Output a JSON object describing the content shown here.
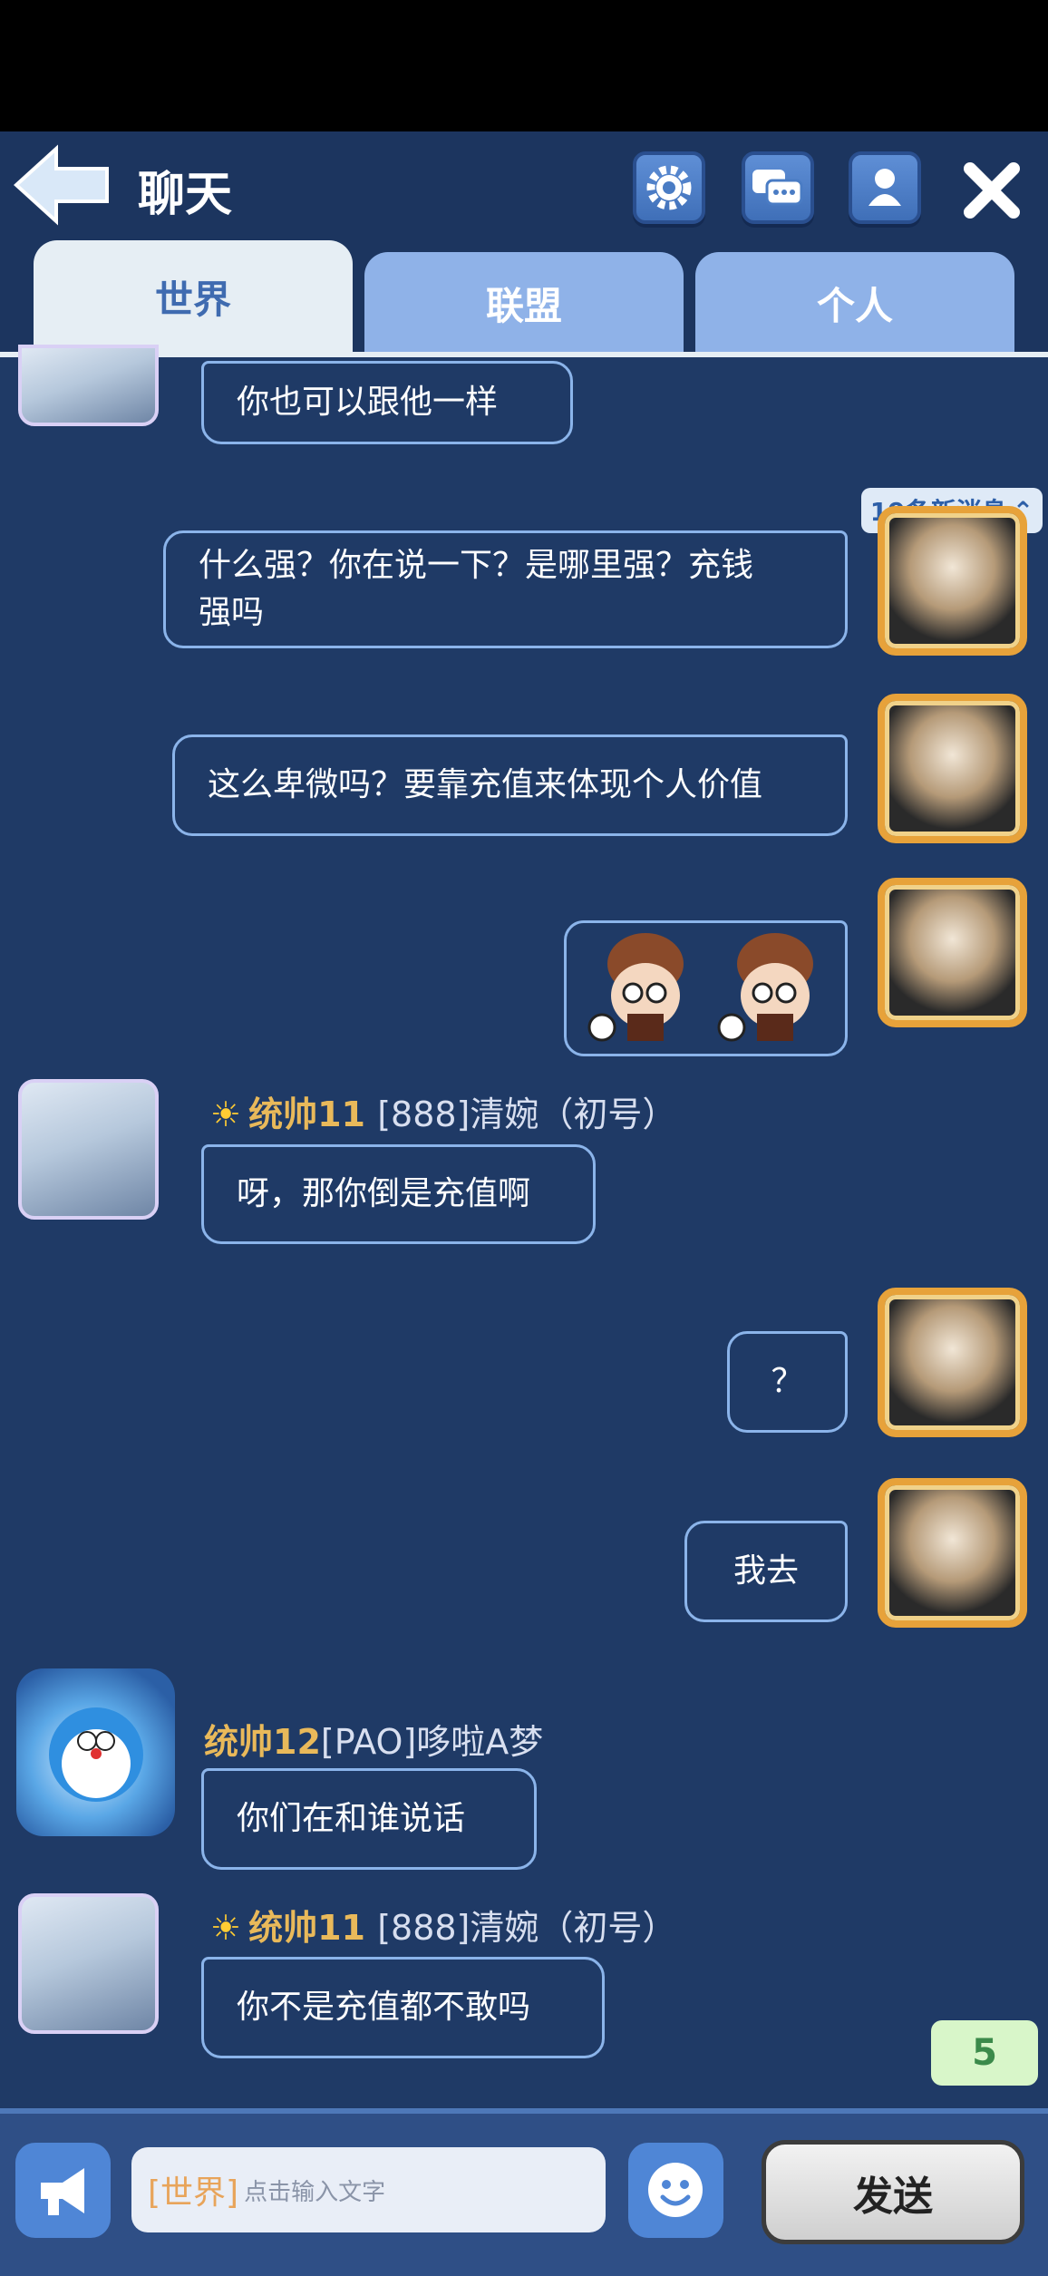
{
  "header": {
    "title": "聊天",
    "tabs": [
      {
        "label": "世界",
        "selected": true
      },
      {
        "label": "联盟",
        "selected": false
      },
      {
        "label": "个人",
        "selected": false
      }
    ],
    "icons": [
      "back-arrow-icon",
      "gear-icon",
      "chat-bubbles-icon",
      "person-icon",
      "close-icon"
    ]
  },
  "new_messages": "19条新消息",
  "messages": [
    {
      "side": "left",
      "text": "你也可以跟他一样"
    },
    {
      "side": "right",
      "text_line1": "什么强？你在说一下？是哪里强？充钱",
      "text_line2": "强吗"
    },
    {
      "side": "right",
      "text": "这么卑微吗？要靠充值来体现个人价值"
    },
    {
      "side": "right",
      "type": "sticker"
    },
    {
      "side": "left",
      "name_prefix": "统帅11",
      "name_rest": "[888]清婉（初号）",
      "text": "呀，那你倒是充值啊"
    },
    {
      "side": "right",
      "text": "？"
    },
    {
      "side": "right",
      "text": "我去"
    },
    {
      "side": "left",
      "name_prefix": "统帅12",
      "name_rest": "[PAO]哆啦A梦",
      "text": "你们在和谁说话"
    },
    {
      "side": "left",
      "name_prefix": "统帅11",
      "name_rest": "[888]清婉（初号）",
      "text": "你不是充值都不敢吗"
    }
  ],
  "unread_count": "5",
  "composer": {
    "channel": "[世界]",
    "placeholder": "点击输入文字",
    "send_label": "发送"
  },
  "colors": {
    "background": "#1f3a66",
    "bubble_border": "#8bb4ea",
    "name_gold": "#e9b95a",
    "tab_active": "#e6eef4",
    "tab_inactive": "#8fb2e8"
  }
}
